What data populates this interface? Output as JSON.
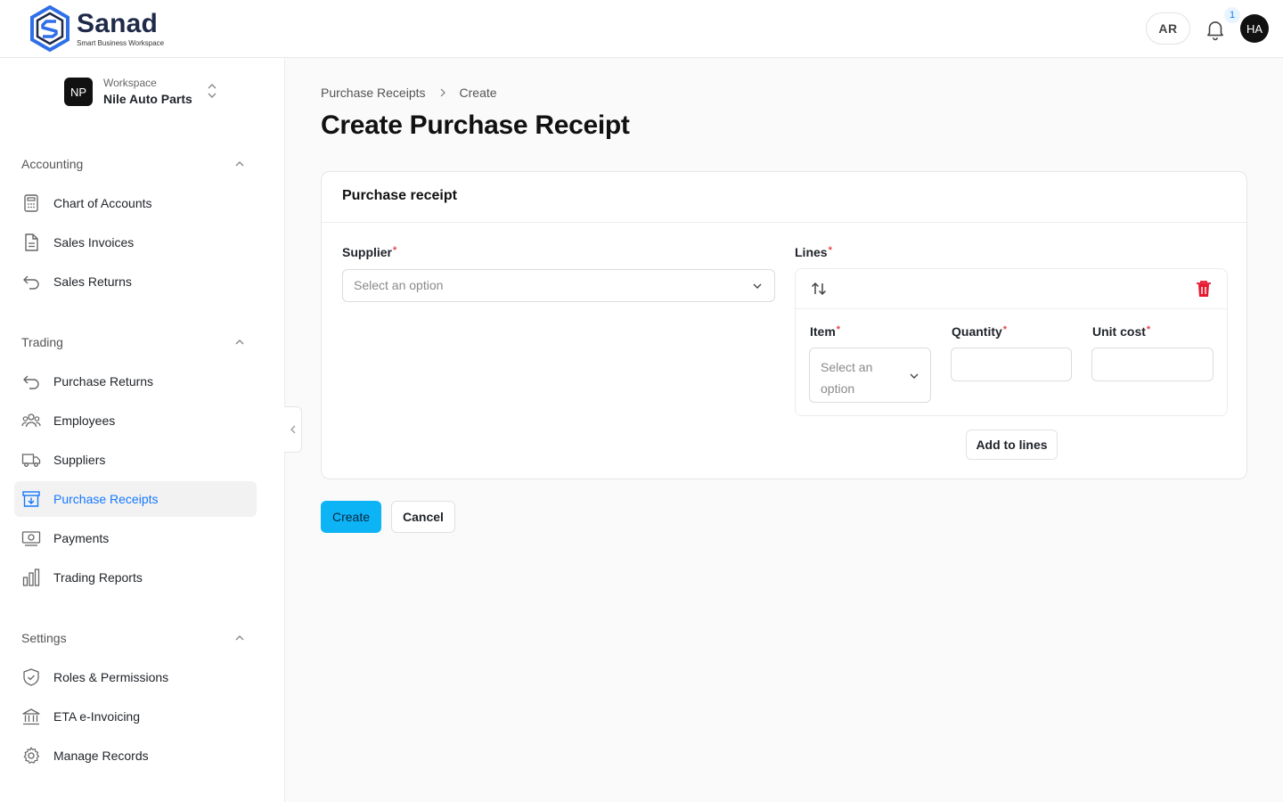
{
  "brand": {
    "name": "Sanad",
    "tagline": "Smart Business Workspace",
    "accent": "#1677ff",
    "logo_colors": [
      "#2f6fe8",
      "#1f2a4a"
    ]
  },
  "header": {
    "language_label": "AR",
    "notification_count": "1",
    "user_initials": "HA",
    "bell_icon": "bell-icon"
  },
  "workspace": {
    "initials": "NP",
    "label": "Workspace",
    "name": "Nile Auto Parts"
  },
  "sidebar": {
    "sections": [
      {
        "title": "Accounting",
        "items": [
          {
            "label": "Chart of Accounts",
            "icon": "calculator-icon"
          },
          {
            "label": "Sales Invoices",
            "icon": "document-icon"
          },
          {
            "label": "Sales Returns",
            "icon": "return-arrow-icon"
          }
        ]
      },
      {
        "title": "Trading",
        "items": [
          {
            "label": "Purchase Returns",
            "icon": "return-arrow-icon"
          },
          {
            "label": "Employees",
            "icon": "users-icon"
          },
          {
            "label": "Suppliers",
            "icon": "truck-icon"
          },
          {
            "label": "Purchase Receipts",
            "icon": "inbox-download-icon",
            "active": true
          },
          {
            "label": "Payments",
            "icon": "banknote-icon"
          },
          {
            "label": "Trading Reports",
            "icon": "bar-chart-icon"
          }
        ]
      },
      {
        "title": "Settings",
        "items": [
          {
            "label": "Roles & Permissions",
            "icon": "shield-check-icon"
          },
          {
            "label": "ETA e-Invoicing",
            "icon": "bank-icon"
          },
          {
            "label": "Manage Records",
            "icon": "gear-icon"
          }
        ]
      }
    ]
  },
  "breadcrumb": {
    "parent": "Purchase Receipts",
    "current": "Create"
  },
  "page": {
    "title": "Create Purchase Receipt"
  },
  "form": {
    "card_title": "Purchase receipt",
    "supplier": {
      "label": "Supplier",
      "placeholder": "Select an option",
      "value": ""
    },
    "lines": {
      "label": "Lines",
      "item": {
        "label": "Item",
        "placeholder_line1": "Select an",
        "placeholder_line2": "option",
        "value": ""
      },
      "quantity": {
        "label": "Quantity",
        "value": ""
      },
      "unit_cost": {
        "label": "Unit cost",
        "value": ""
      },
      "add_button": "Add to lines"
    },
    "required_marker": "*"
  },
  "actions": {
    "create": "Create",
    "cancel": "Cancel"
  }
}
